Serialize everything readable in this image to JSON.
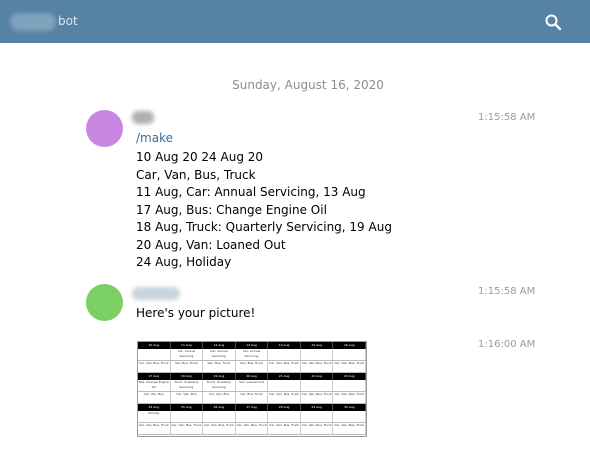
{
  "header": {
    "bot_name": "bot",
    "colors": {
      "bar": "#5682a3"
    }
  },
  "date_separator": "Sunday, August 16, 2020",
  "messages": [
    {
      "avatar_color": "#c787e0",
      "time": "1:15:58 AM",
      "command": "/make",
      "lines": [
        "10 Aug 20 24 Aug 20",
        "Car, Van, Bus, Truck",
        "11 Aug, Car: Annual Servicing, 13 Aug",
        "17 Aug, Bus: Change Engine Oil",
        "18 Aug, Truck: Quarterly Servicing, 19 Aug",
        "20 Aug, Van: Loaned Out",
        "24 Aug, Holiday"
      ]
    },
    {
      "avatar_color": "#7ccf64",
      "time": "1:15:58 AM",
      "text": "Here's your picture!"
    },
    {
      "time": "1:16:00 AM",
      "picture_weeks": [
        {
          "days": [
            "10 Aug",
            "11 Aug",
            "12 Aug",
            "13 Aug",
            "14 Aug",
            "15 Aug",
            "16 Aug"
          ],
          "row1": [
            "",
            "Car: Annual Servicing",
            "Car: Annual Servicing",
            "Car: Annual Servicing",
            "",
            "",
            ""
          ],
          "row2": [
            "Car, Van, Bus, Truck",
            "Van, Bus, Truck",
            "Van, Bus, Truck",
            "Van, Bus, Truck",
            "Car, Van, Bus, Truck",
            "Car, Van, Bus, Truck",
            "Car, Van, Bus, Truck"
          ]
        },
        {
          "days": [
            "17 Aug",
            "18 Aug",
            "19 Aug",
            "20 Aug",
            "21 Aug",
            "22 Aug",
            "23 Aug"
          ],
          "row1": [
            "Bus: Change Engine Oil",
            "Truck: Quarterly Servicing",
            "Truck: Quarterly Servicing",
            "Van: Loaned Out",
            "",
            "",
            ""
          ],
          "row2": [
            "Car, Van, Bus",
            "Car, Van, Bus",
            "Car, Van, Bus",
            "Car, Bus, Truck",
            "Car, Van, Bus, Truck",
            "Car, Van, Bus, Truck",
            "Car, Van, Bus, Truck"
          ]
        },
        {
          "days": [
            "24 Aug",
            "25 Aug",
            "26 Aug",
            "27 Aug",
            "28 Aug",
            "29 Aug",
            "30 Aug"
          ],
          "row1": [
            "Holiday",
            "",
            "",
            "",
            "",
            "",
            ""
          ],
          "row2": [
            "Car, Van, Bus, Truck",
            "Car, Van, Bus, Truck",
            "Car, Van, Bus, Truck",
            "Car, Van, Bus, Truck",
            "Car, Van, Bus, Truck",
            "Car, Van, Bus, Truck",
            "Car, Van, Bus, Truck"
          ]
        }
      ]
    }
  ]
}
